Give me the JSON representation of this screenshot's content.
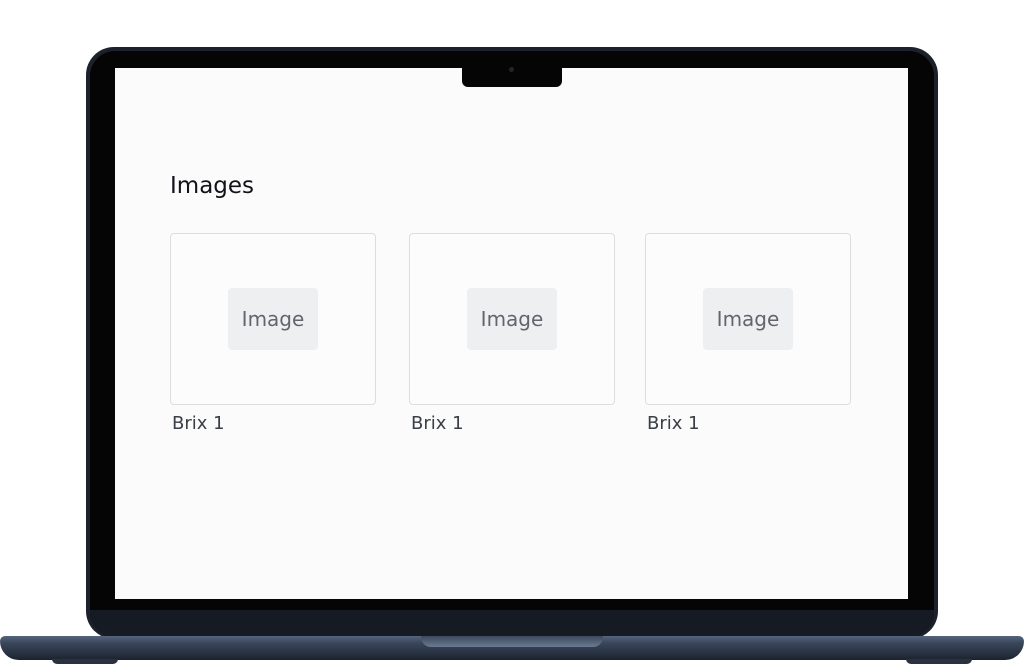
{
  "page": {
    "title": "Images"
  },
  "cards": [
    {
      "placeholder": "Image",
      "caption": "Brix 1"
    },
    {
      "placeholder": "Image",
      "caption": "Brix 1"
    },
    {
      "placeholder": "Image",
      "caption": "Brix 1"
    }
  ],
  "colors": {
    "laptop_body": "#1c212b",
    "bezel": "#050506",
    "screen_bg": "#fbfbfc",
    "card_border": "#dcdde0",
    "placeholder_bg": "#eeeff1",
    "caption_text": "#3a3e45"
  }
}
